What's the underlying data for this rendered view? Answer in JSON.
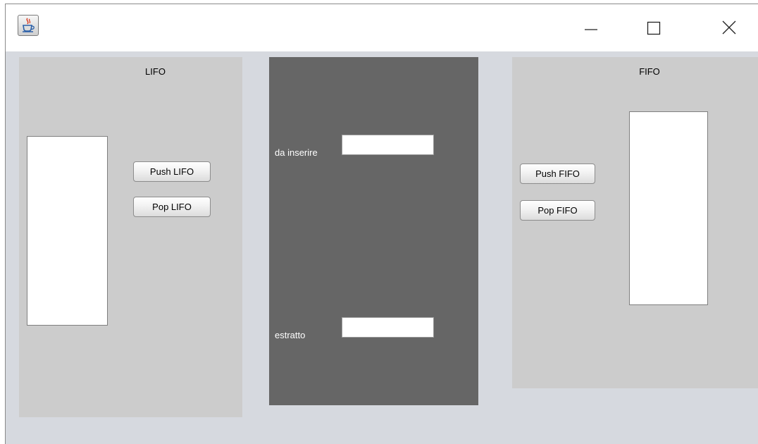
{
  "window": {
    "controls": {
      "minimize_icon": "minimize-icon",
      "maximize_icon": "maximize-icon",
      "close_icon": "close-icon"
    },
    "app_icon": "java-cup-icon"
  },
  "lifo": {
    "title": "LIFO",
    "push_label": "Push LIFO",
    "pop_label": "Pop LIFO",
    "items": []
  },
  "center": {
    "insert_label": "da inserire",
    "insert_value": "",
    "extracted_label": "estratto",
    "extracted_value": ""
  },
  "fifo": {
    "title": "FIFO",
    "push_label": "Push FIFO",
    "pop_label": "Pop FIFO",
    "items": []
  },
  "colors": {
    "window_bg": "#d6d9df",
    "side_panel": "#cccccc",
    "center_panel": "#666666",
    "titlebar": "#ffffff"
  }
}
